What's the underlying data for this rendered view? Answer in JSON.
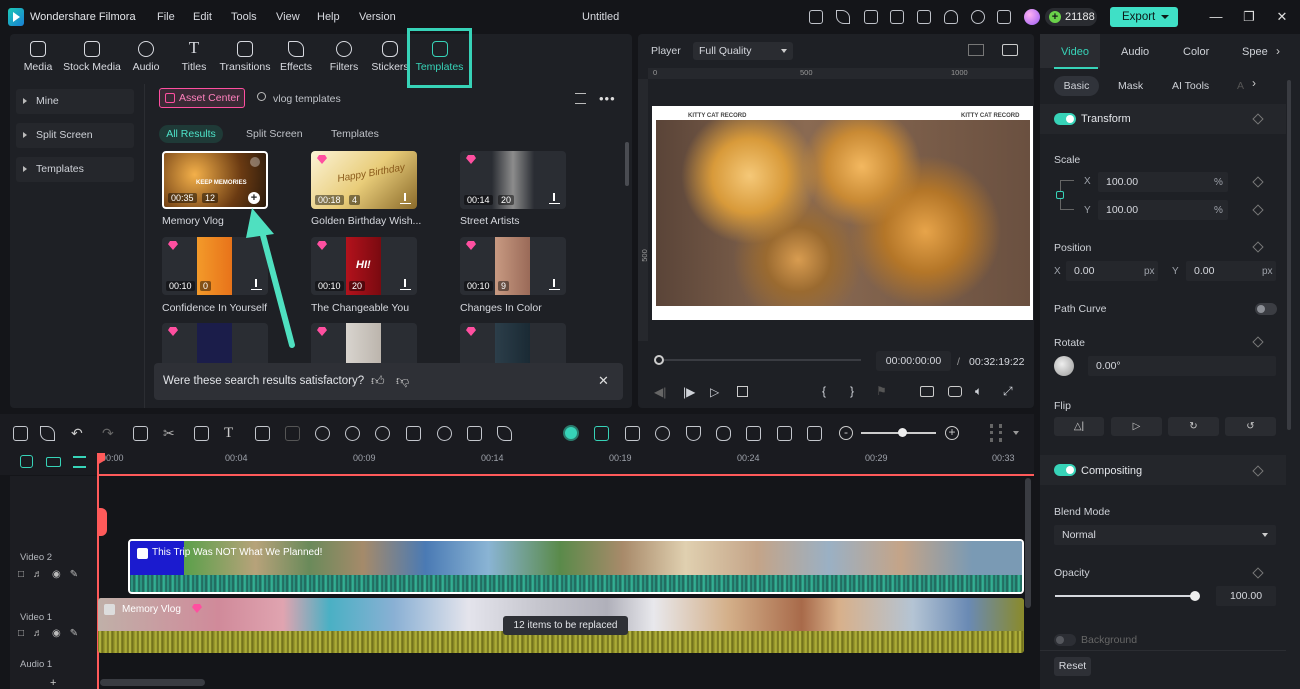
{
  "app": {
    "name": "Wondershare Filmora",
    "doc_title": "Untitled",
    "credits": "21188",
    "export_label": "Export"
  },
  "menu": [
    "File",
    "Edit",
    "Tools",
    "View",
    "Help",
    "Version"
  ],
  "library_tabs": [
    "Media",
    "Stock Media",
    "Audio",
    "Titles",
    "Transitions",
    "Effects",
    "Filters",
    "Stickers",
    "Templates"
  ],
  "sidebar": [
    "Mine",
    "Split Screen",
    "Templates"
  ],
  "asset_center": "Asset Center",
  "search": {
    "value": "vlog templates"
  },
  "filters": [
    "All Results",
    "Split Screen",
    "Templates"
  ],
  "templates": [
    {
      "name": "Memory Vlog",
      "duration": "00:35",
      "count": "12"
    },
    {
      "name": "Golden Birthday Wish...",
      "duration": "00:18",
      "count": "4"
    },
    {
      "name": "Street Artists",
      "duration": "00:14",
      "count": "20"
    },
    {
      "name": "Confidence In Yourself",
      "duration": "00:10",
      "count": "0"
    },
    {
      "name": "The Changeable You",
      "duration": "00:10",
      "count": "20"
    },
    {
      "name": "Changes In Color",
      "duration": "00:10",
      "count": "9"
    }
  ],
  "thumb_text": {
    "memory": "KEEP MEMORIES",
    "birthday": "Happy Birthday",
    "changeable": "HI!"
  },
  "feedback": "Were these search results satisfactory?",
  "player": {
    "label": "Player",
    "quality": "Full Quality",
    "current_time": "00:00:00:00",
    "separator": "/",
    "total_time": "00:32:19:22",
    "preview_text_left": "KITTY CAT RECORD",
    "preview_text_right": "KITTY CAT RECORD",
    "ruler": [
      "0",
      "500",
      "1000"
    ],
    "side_ruler": "500"
  },
  "right_panel": {
    "tabs": [
      "Video",
      "Audio",
      "Color",
      "Spee"
    ],
    "subtabs": [
      "Basic",
      "Mask",
      "AI Tools",
      "A"
    ],
    "transform": "Transform",
    "scale": "Scale",
    "scale_x": "100.00",
    "scale_y": "100.00",
    "pct": "%",
    "position": "Position",
    "pos_x": "0.00",
    "pos_y": "0.00",
    "px": "px",
    "axis_x": "X",
    "axis_y": "Y",
    "path_curve": "Path Curve",
    "rotate": "Rotate",
    "rotate_value": "0.00°",
    "flip": "Flip",
    "compositing": "Compositing",
    "blend_mode": "Blend Mode",
    "blend_value": "Normal",
    "opacity": "Opacity",
    "opacity_value": "100.00",
    "background": "Background",
    "reset": "Reset"
  },
  "opacity_level": 1.0,
  "timeline": {
    "ruler": [
      "00:00",
      "00:04",
      "00:09",
      "00:14",
      "00:19",
      "00:24",
      "00:29",
      "00:33"
    ],
    "tracks": [
      "Video 2",
      "Video 1",
      "Audio 1"
    ],
    "clip2_title": "This Trip Was NOT What We Planned!",
    "clip1_title": "Memory Vlog",
    "replace_tooltip": "12 items to be replaced"
  },
  "colors": {
    "accent": "#37d3b8",
    "export": "#3fe0c6",
    "asset_center": "#ff4fa0",
    "playhead": "#ff5a5a"
  }
}
